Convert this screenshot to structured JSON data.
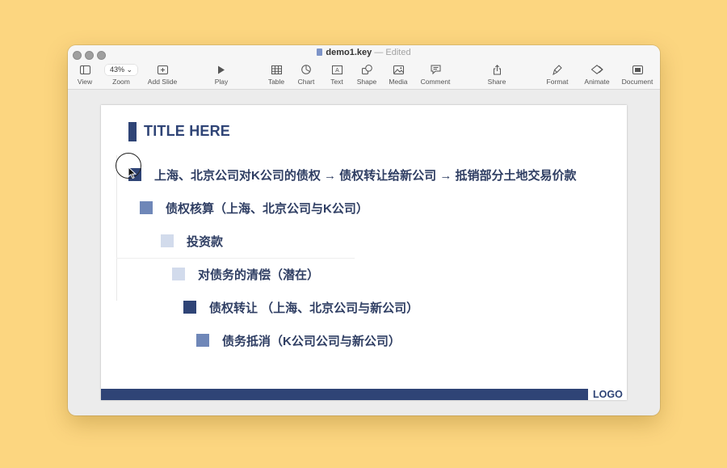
{
  "window": {
    "file_name": "demo1.key",
    "separator": "—",
    "status": "Edited"
  },
  "toolbar": {
    "view": "View",
    "zoom_value": "43%",
    "zoom": "Zoom",
    "add_slide": "Add Slide",
    "play": "Play",
    "table": "Table",
    "chart": "Chart",
    "text": "Text",
    "shape": "Shape",
    "media": "Media",
    "comment": "Comment",
    "share": "Share",
    "format": "Format",
    "animate": "Animate",
    "document": "Document"
  },
  "slide": {
    "title": "TITLE HERE",
    "bullets": [
      {
        "text": "上海、北京公司对K公司的债权 → 债权转让给新公司 → 抵销部分土地交易价款",
        "color": "#2f4476"
      },
      {
        "text": "债权核算（上海、北京公司与K公司）",
        "color": "#6f87b8"
      },
      {
        "text": "投资款",
        "color": "#d2dbec"
      },
      {
        "text": "对债务的清偿（潜在）",
        "color": "#d2dbec"
      },
      {
        "text": "债权转让 （上海、北京公司与新公司）",
        "color": "#2f4476"
      },
      {
        "text": "债务抵消（K公司公司与新公司）",
        "color": "#6f87b8"
      }
    ],
    "logo": "LOGO"
  },
  "colors": {
    "background": "#fcd680",
    "accent": "#2f4476"
  }
}
